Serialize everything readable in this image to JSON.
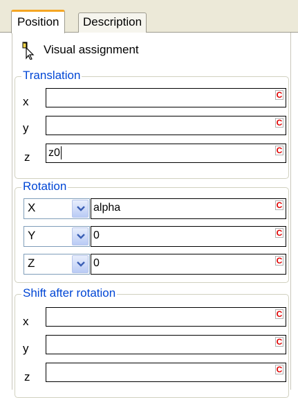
{
  "tabs": [
    {
      "label": "Position",
      "active": true
    },
    {
      "label": "Description",
      "active": false
    }
  ],
  "visual_assignment": {
    "label": "Visual assignment",
    "icon": "pointer-pencil-icon"
  },
  "translation": {
    "title": "Translation",
    "rows": [
      {
        "label": "x",
        "value": ""
      },
      {
        "label": "y",
        "value": ""
      },
      {
        "label": "z",
        "value": "z0"
      }
    ]
  },
  "rotation": {
    "title": "Rotation",
    "rows": [
      {
        "axis": "X",
        "value": "alpha"
      },
      {
        "axis": "Y",
        "value": "0"
      },
      {
        "axis": "Z",
        "value": "0"
      }
    ]
  },
  "shift": {
    "title": "Shift after rotation",
    "rows": [
      {
        "label": "x",
        "value": ""
      },
      {
        "label": "y",
        "value": ""
      },
      {
        "label": "z",
        "value": ""
      }
    ]
  },
  "constant_button_label": "C",
  "colors": {
    "legend": "#0046d5",
    "tab_highlight": "#f5a623",
    "constant_button": "#e00000"
  }
}
